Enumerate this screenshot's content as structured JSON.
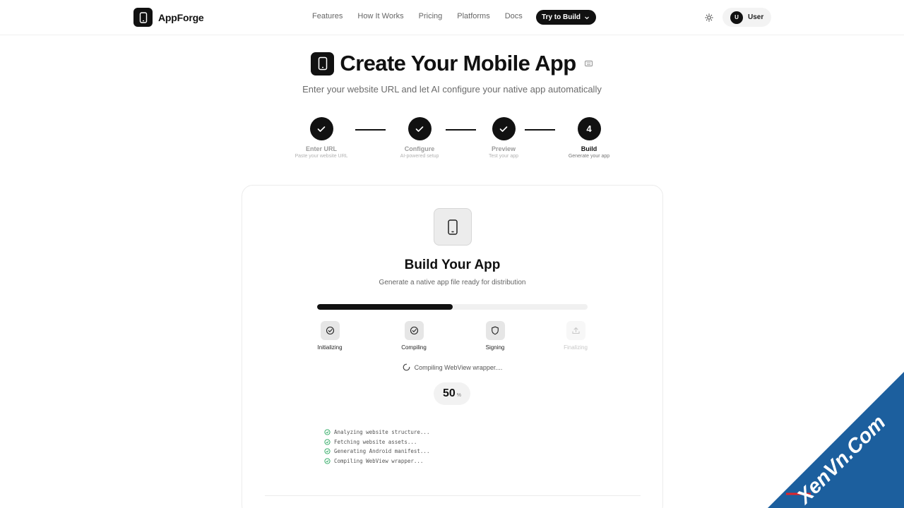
{
  "header": {
    "brand": "AppForge",
    "nav": [
      "Features",
      "How It Works",
      "Pricing",
      "Platforms",
      "Docs"
    ],
    "cta_label": "Try to Build",
    "user_initial": "U",
    "user_name": "User"
  },
  "hero": {
    "title": "Create Your Mobile App",
    "subtitle": "Enter your website URL and let AI configure your native app automatically"
  },
  "steps": [
    {
      "title": "Enter URL",
      "sub": "Paste your website URL",
      "state": "done"
    },
    {
      "title": "Configure",
      "sub": "AI-powered setup",
      "state": "done"
    },
    {
      "title": "Preview",
      "sub": "Test your app",
      "state": "done"
    },
    {
      "number": "4",
      "title": "Build",
      "sub": "Generate your app",
      "state": "active"
    }
  ],
  "card": {
    "title": "Build Your App",
    "subtitle": "Generate a native app file ready for distribution",
    "progress": 0.5,
    "stages": [
      {
        "label": "Initializing",
        "state": "done",
        "icon": "check-circle-icon"
      },
      {
        "label": "Compiling",
        "state": "done",
        "icon": "check-circle-icon"
      },
      {
        "label": "Signing",
        "state": "active",
        "icon": "shield-icon"
      },
      {
        "label": "Finalizing",
        "state": "pending",
        "icon": "upload-icon"
      }
    ],
    "status": "Compiling WebView wrapper....",
    "percent": "50",
    "percent_unit": "%",
    "log": [
      "Analyzing website structure...",
      "Fetching website assets...",
      "Generating Android manifest...",
      "Compiling WebView wrapper..."
    ]
  },
  "colors": {
    "primary": "#111111",
    "muted_text": "#6b6b6b",
    "log_check": "#22a55a",
    "watermark_blue": "#1c5f9e"
  },
  "watermark": {
    "text": "XenVn.Com"
  }
}
